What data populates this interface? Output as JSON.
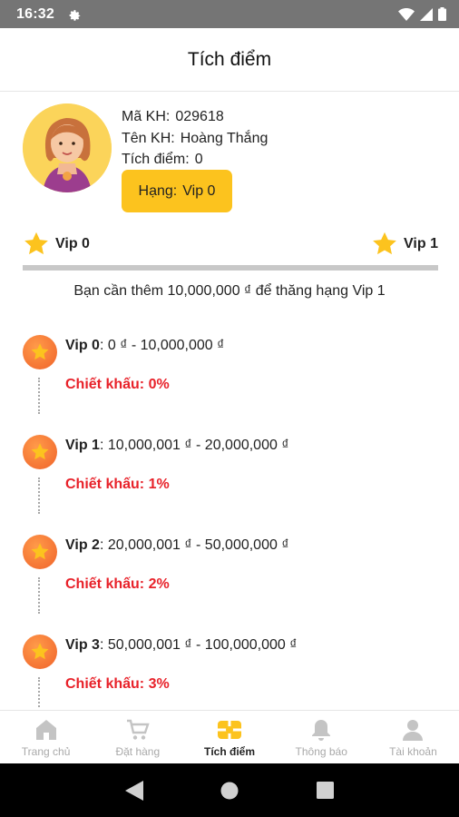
{
  "status_bar": {
    "time": "16:32"
  },
  "app_bar": {
    "title": "Tích điểm"
  },
  "profile": {
    "customer_code_label": "Mã KH:",
    "customer_code": "029618",
    "customer_name_label": "Tên KH:",
    "customer_name": "Hoàng Thắng",
    "points_label": "Tích điểm:",
    "points": "0",
    "rank_label": "Hạng:",
    "rank": "Vip 0"
  },
  "progress": {
    "current_label": "Vip 0",
    "next_label": "Vip 1",
    "fraction": 0,
    "message": "Bạn cần thêm 10,000,000 ₫ để thăng hạng Vip 1"
  },
  "tiers": [
    {
      "name": "Vip 0",
      "range": ": 0 ₫ - 10,000,000 ₫",
      "discount": "Chiết khấu: 0%"
    },
    {
      "name": "Vip 1",
      "range": ": 10,000,001 ₫ - 20,000,000 ₫",
      "discount": "Chiết khấu: 1%"
    },
    {
      "name": "Vip 2",
      "range": ": 20,000,001 ₫ - 50,000,000 ₫",
      "discount": "Chiết khấu: 2%"
    },
    {
      "name": "Vip 3",
      "range": ": 50,000,001 ₫ - 100,000,000 ₫",
      "discount": "Chiết khấu: 3%"
    }
  ],
  "bottom_nav": [
    {
      "label": "Trang chủ",
      "icon": "home-icon",
      "active": false
    },
    {
      "label": "Đặt hàng",
      "icon": "cart-icon",
      "active": false
    },
    {
      "label": "Tích điểm",
      "icon": "points-icon",
      "active": true
    },
    {
      "label": "Thông báo",
      "icon": "bell-icon",
      "active": false
    },
    {
      "label": "Tài khoản",
      "icon": "account-icon",
      "active": false
    }
  ],
  "colors": {
    "accent": "#fcc31e",
    "discount_red": "#e8222a",
    "tier_orange": "#f0622a",
    "inactive_gray": "#a9a9a9"
  }
}
